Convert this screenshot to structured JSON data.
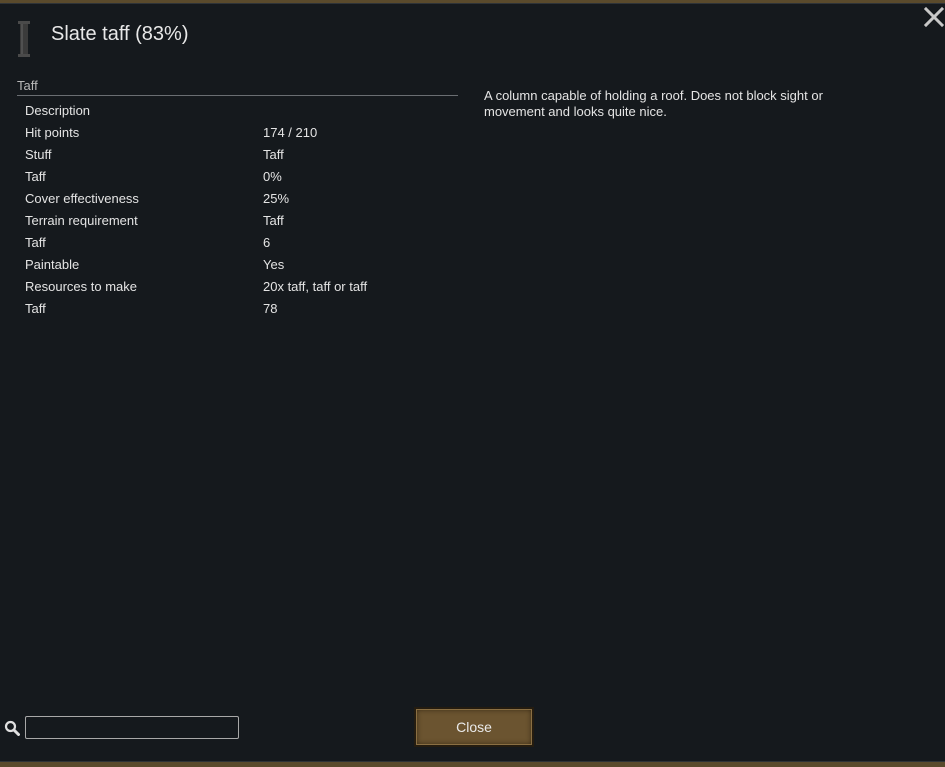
{
  "title": "Slate taff (83%)",
  "category": "Taff",
  "stats": [
    {
      "label": "Description",
      "value": ""
    },
    {
      "label": "Hit points",
      "value": "174 / 210"
    },
    {
      "label": "Stuff",
      "value": "Taff"
    },
    {
      "label": "Taff",
      "value": "0%"
    },
    {
      "label": "Cover effectiveness",
      "value": "25%"
    },
    {
      "label": "Terrain requirement",
      "value": "Taff"
    },
    {
      "label": "Taff",
      "value": "6"
    },
    {
      "label": "Paintable",
      "value": "Yes"
    },
    {
      "label": "Resources to make",
      "value": "20x taff, taff or taff"
    },
    {
      "label": "Taff",
      "value": "78"
    }
  ],
  "description": "A column capable of holding a roof. Does not block sight or movement and looks quite nice.",
  "search": {
    "value": "",
    "placeholder": ""
  },
  "buttons": {
    "close_label": "Close"
  },
  "icons": {
    "thing": "pillar-icon",
    "close": "close-icon",
    "search": "search-icon"
  },
  "colors": {
    "panel_bg": "#15191d",
    "button_bg": "#6b5430",
    "text": "#e4e4e4"
  }
}
